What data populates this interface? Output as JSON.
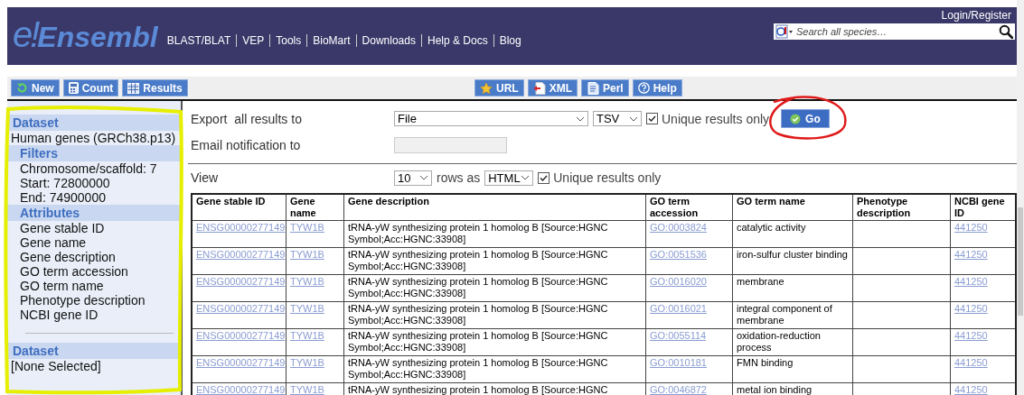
{
  "header": {
    "logo_mark": "e!",
    "logo_text": "Ensembl",
    "nav": [
      "BLAST/BLAT",
      "VEP",
      "Tools",
      "BioMart",
      "Downloads",
      "Help & Docs",
      "Blog"
    ],
    "login": "Login/Register",
    "search": {
      "placeholder": "Search all species…"
    }
  },
  "toolbar": {
    "left": [
      {
        "label": "New",
        "kind": "refresh"
      },
      {
        "label": "Count",
        "kind": "calculator"
      },
      {
        "label": "Results",
        "kind": "table"
      }
    ],
    "right": [
      {
        "label": "URL",
        "kind": "star"
      },
      {
        "label": "XML",
        "kind": "xml"
      },
      {
        "label": "Perl",
        "kind": "perl"
      },
      {
        "label": "Help",
        "kind": "help"
      }
    ]
  },
  "sidebar": [
    {
      "kind": "dataset",
      "heading": "Dataset",
      "items": [
        "Human genes (GRCh38.p13)"
      ]
    },
    {
      "kind": "group",
      "heading": "Filters",
      "items": [
        "Chromosome/scaffold: 7",
        "Start: 72800000",
        "End: 74900000"
      ]
    },
    {
      "kind": "group",
      "heading": "Attributes",
      "items": [
        "Gene stable ID",
        "Gene name",
        "Gene description",
        "GO term accession",
        "GO term name",
        "Phenotype description",
        "NCBI gene ID"
      ]
    },
    {
      "kind": "dataset",
      "heading": "Dataset",
      "items": [
        "[None Selected]"
      ]
    }
  ],
  "export": {
    "label": "Export  all results to",
    "destination": "File",
    "format": "TSV",
    "unique": {
      "label": "Unique results only",
      "checked": true
    },
    "go": "Go"
  },
  "email": {
    "label": "Email notification to",
    "disabled": true
  },
  "view": {
    "label": "View",
    "rows": "10",
    "rows_as": "rows as",
    "format": "HTML",
    "unique": {
      "label": "Unique results only",
      "checked": true
    }
  },
  "table": {
    "columns": [
      {
        "label": "Gene stable ID",
        "kind": "link"
      },
      {
        "label": "Gene name",
        "kind": "link"
      },
      {
        "label": "Gene description",
        "kind": "text"
      },
      {
        "label": "GO term accession",
        "kind": "link"
      },
      {
        "label": "GO term name",
        "kind": "text"
      },
      {
        "label": "Phenotype description"
      },
      {
        "label": "NCBI gene ID",
        "kind": "link"
      }
    ],
    "rows": [
      [
        "ENSG00000277149",
        "TYW1B",
        "tRNA-yW synthesizing protein 1 homolog B [Source:HGNC Symbol;Acc:HGNC:33908]",
        "GO:0003824",
        "catalytic activity",
        null,
        "441250"
      ],
      [
        "ENSG00000277149",
        "TYW1B",
        "tRNA-yW synthesizing protein 1 homolog B [Source:HGNC Symbol;Acc:HGNC:33908]",
        "GO:0051536",
        "iron-sulfur cluster binding",
        null,
        "441250"
      ],
      [
        "ENSG00000277149",
        "TYW1B",
        "tRNA-yW synthesizing protein 1 homolog B [Source:HGNC Symbol;Acc:HGNC:33908]",
        "GO:0016020",
        "membrane",
        null,
        "441250"
      ],
      [
        "ENSG00000277149",
        "TYW1B",
        "tRNA-yW synthesizing protein 1 homolog B [Source:HGNC Symbol;Acc:HGNC:33908]",
        "GO:0016021",
        "integral component of membrane",
        null,
        "441250"
      ],
      [
        "ENSG00000277149",
        "TYW1B",
        "tRNA-yW synthesizing protein 1 homolog B [Source:HGNC Symbol;Acc:HGNC:33908]",
        "GO:0055114",
        "oxidation-reduction process",
        null,
        "441250"
      ],
      [
        "ENSG00000277149",
        "TYW1B",
        "tRNA-yW synthesizing protein 1 homolog B [Source:HGNC Symbol;Acc:HGNC:33908]",
        "GO:0010181",
        "FMN binding",
        null,
        "441250"
      ],
      [
        "ENSG00000277149",
        "TYW1B",
        "tRNA-yW synthesizing protein 1 homolog B [Source:HGNC",
        "GO:0046872",
        "metal ion binding",
        null,
        "441250"
      ]
    ]
  }
}
